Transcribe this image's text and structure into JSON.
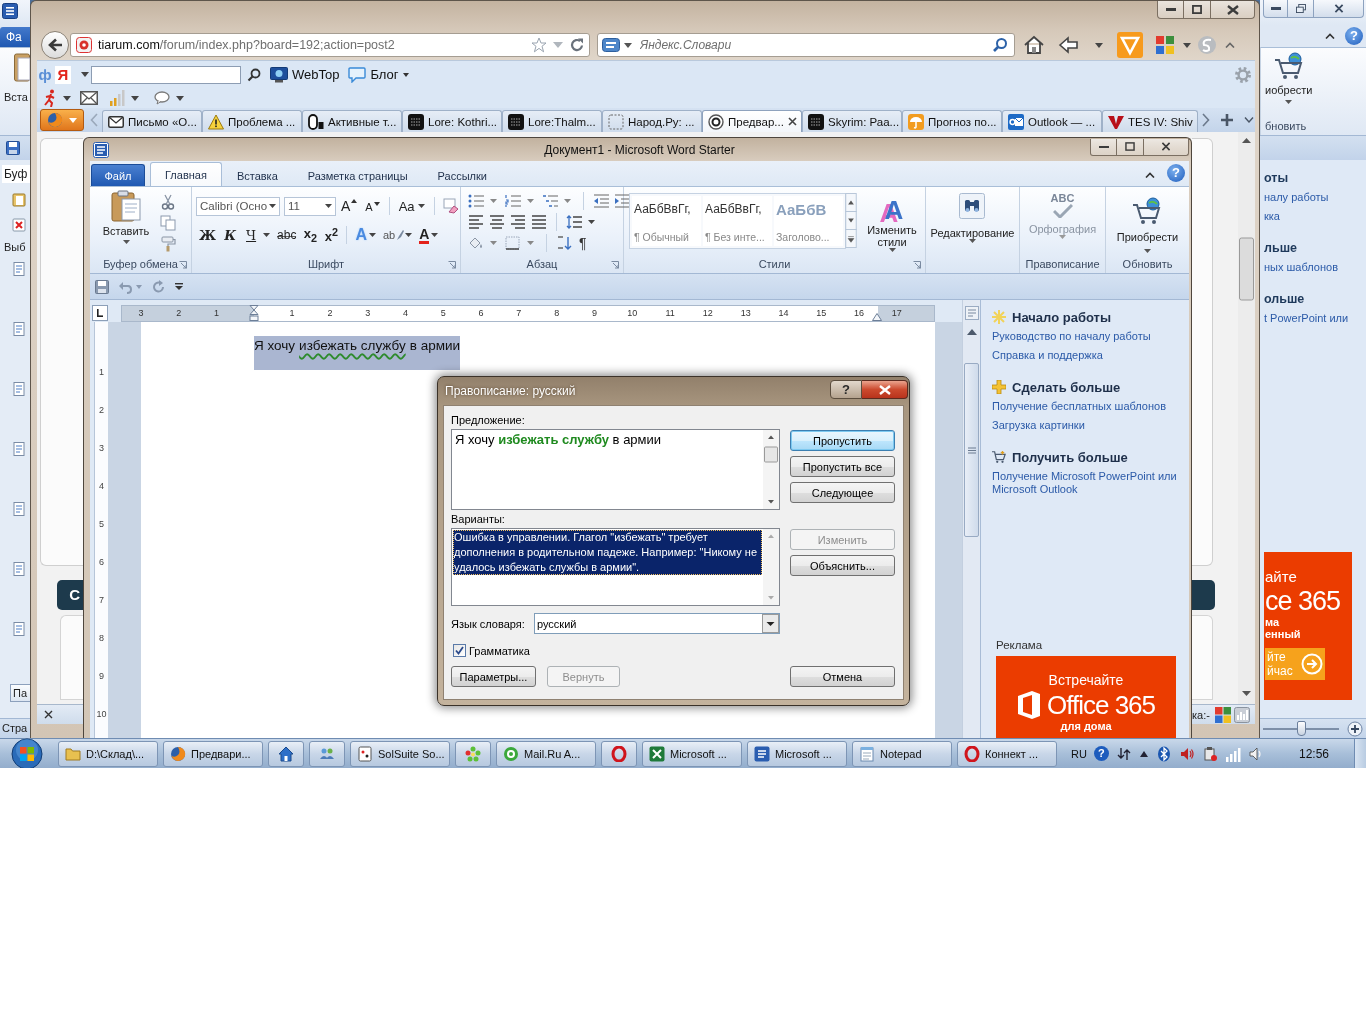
{
  "background_window": {
    "left": {
      "file_tab": "Фа",
      "paste_label": "Вста",
      "pane_title": "Буф",
      "pane_label": "Выб",
      "pane_button": "Па",
      "status": "Стра"
    },
    "right": {
      "help": "?",
      "buy_label": "иобрести",
      "group_label": "бновить",
      "pane": [
        {
          "kind": "heading",
          "text": "оты"
        },
        {
          "kind": "link",
          "text": "налу работы"
        },
        {
          "kind": "link",
          "text": "кка"
        },
        {
          "kind": "heading",
          "text": "льше"
        },
        {
          "kind": "link",
          "text": "ных шаблонов"
        },
        {
          "kind": "heading",
          "text": "ольше"
        },
        {
          "kind": "link",
          "text": "t PowerPoint или"
        }
      ],
      "ad_title": "айте",
      "ad_product": "ce 365",
      "ad_small_lines": [
        "ма",
        "енный"
      ],
      "ad_button_lines": [
        "йте",
        "йчас"
      ],
      "zoom_slider": {
        "level": 0.5
      }
    }
  },
  "browser": {
    "address": {
      "host": "tiarum.com",
      "path": "/forum/index.php?board=192;action=post2"
    },
    "search": {
      "placeholder": "Яндекс.Словари"
    },
    "toolbar_marks": [
      {
        "text": "ф",
        "color": "#5b8fd6"
      },
      {
        "text": "Я",
        "color": "#e3241b"
      }
    ],
    "toolbar_buttons": [
      {
        "label": "WebTop",
        "kind": "monitor",
        "menu": false
      },
      {
        "label": "Блог",
        "kind": "bubble",
        "menu": true
      }
    ],
    "tabs": [
      {
        "label": "Письмо «О...",
        "kind": "envelope",
        "selected": false
      },
      {
        "label": "Проблема ...",
        "kind": "warning",
        "selected": false
      },
      {
        "label": "Активные т...",
        "kind": "capsule",
        "selected": false
      },
      {
        "label": "Lore: Kothri...",
        "kind": "dark-tile",
        "selected": false
      },
      {
        "label": "Lore:Thalm...",
        "kind": "dark-tile",
        "selected": false
      },
      {
        "label": "Народ.Ру: ...",
        "kind": "dashed",
        "selected": false
      },
      {
        "label": "Предвар...",
        "kind": "round",
        "selected": true
      },
      {
        "label": "Skyrim: Раа...",
        "kind": "dark-tile",
        "selected": false
      },
      {
        "label": "Прогноз по...",
        "kind": "umbrella",
        "selected": false
      },
      {
        "label": "Outlook — ...",
        "kind": "mail-tile",
        "selected": false
      },
      {
        "label": "TES IV: Shiv",
        "kind": "v-mark",
        "selected": false
      }
    ],
    "page_heading": "C",
    "status": "ка:-"
  },
  "word": {
    "title": "Документ1 - Microsoft Word Starter",
    "help": "?",
    "tabs": [
      {
        "label": "Файл",
        "kind": "file",
        "selected": false
      },
      {
        "label": "Главная",
        "kind": "tab",
        "selected": true
      },
      {
        "label": "Вставка",
        "kind": "tab",
        "selected": false
      },
      {
        "label": "Разметка страницы",
        "kind": "tab",
        "selected": false
      },
      {
        "label": "Рассылки",
        "kind": "tab",
        "selected": false
      }
    ],
    "clipboard": {
      "paste": "Вставить",
      "label": "Буфер обмена"
    },
    "font": {
      "name": "Calibri (Осно",
      "size": "11",
      "grow": "A",
      "shrink": "A",
      "case": "Aa",
      "formats": [
        {
          "label": "Ж",
          "kind": "bold"
        },
        {
          "label": "К",
          "kind": "italic"
        },
        {
          "label": "Ч",
          "kind": "underline"
        },
        {
          "label": "abc",
          "kind": "strike"
        },
        {
          "label": "x$_{2}$",
          "kind": "sub"
        },
        {
          "label": "x$^{2}$",
          "kind": "sup"
        }
      ],
      "effects": "A",
      "highlight": "ab",
      "color_glyph": "A",
      "label": "Шрифт"
    },
    "paragraph": {
      "pilcrow": "¶",
      "label": "Абзац"
    },
    "styles": {
      "items": [
        {
          "sample": "АаБбВвГг,",
          "name": "¶ Обычный",
          "kind": "body"
        },
        {
          "sample": "АаБбВвГг,",
          "name": "¶ Без инте...",
          "kind": "body"
        },
        {
          "sample": "АаБбВ",
          "name": "Заголово...",
          "kind": "heading"
        }
      ],
      "change_glyph": "A",
      "change_lines": [
        "Изменить",
        "стили"
      ],
      "label": "Стили"
    },
    "editing": {
      "button": "Редактирование"
    },
    "proofing": {
      "glyph": "ABC",
      "button": "Орфография",
      "disabled": true,
      "label": "Правописание"
    },
    "upgrade": {
      "button": "Приобрести",
      "label": "Обновить"
    },
    "ruler": {
      "labels": [
        "3",
        "2",
        "1",
        "1",
        "2",
        "3",
        "4",
        "5",
        "6",
        "7",
        "8",
        "9",
        "10",
        "11",
        "12",
        "13",
        "14",
        "15",
        "16",
        "17"
      ],
      "vertical_labels": [
        "1",
        "2",
        "3",
        "4",
        "5",
        "6",
        "7",
        "8",
        "9",
        "10"
      ]
    },
    "document": {
      "selected": true,
      "segments": [
        {
          "text": "Я хочу",
          "flagged": false
        },
        {
          "text": "избежать службу",
          "flagged": true
        },
        {
          "text": "в армии",
          "flagged": false
        }
      ]
    },
    "task_pane": {
      "sections": [
        {
          "kind": "start",
          "heading": "Начало работы",
          "links": [
            "Руководство по началу работы",
            "Справка и поддержка"
          ]
        },
        {
          "kind": "more",
          "heading": "Сделать больше",
          "links": [
            "Получение бесплатных шаблонов",
            "Загрузка картинки"
          ]
        },
        {
          "kind": "get",
          "heading": "Получить больше",
          "links": [
            "Получение Microsoft PowerPoint или Microsoft Outlook"
          ]
        }
      ],
      "ad_label": "Реклама",
      "ad": {
        "title": "Встречайте",
        "product": "Office 365",
        "subtitle": "для дома"
      }
    }
  },
  "dialog": {
    "title": "Правописание: русский",
    "help": "?",
    "sentence_label": "Предложение:",
    "sentence": "Я хочу **избежать службу** в армии",
    "side_buttons": [
      {
        "label": "Пропустить",
        "default": true,
        "disabled": false
      },
      {
        "label": "Пропустить все",
        "default": false,
        "disabled": false
      },
      {
        "label": "Следующее",
        "default": false,
        "disabled": false
      }
    ],
    "suggestions_label": "Варианты:",
    "suggestions": [
      {
        "text": "Ошибка в управлении. Глагол \"избежать\" требует дополнения в родительном падеже. Например: \"Никому не удалось избежать службы в армии\".",
        "selected": true
      }
    ],
    "suggestion_buttons": [
      {
        "label": "Изменить",
        "disabled": true
      },
      {
        "label": "Объяснить...",
        "disabled": false
      }
    ],
    "language_label": "Язык словаря:",
    "language": "русский",
    "grammar": {
      "label": "Грамматика",
      "checked": true
    },
    "footer_buttons": [
      {
        "label": "Параметры...",
        "disabled": false
      },
      {
        "label": "Вернуть",
        "disabled": true
      },
      {
        "label": "Отмена",
        "disabled": false
      }
    ]
  },
  "taskbar": {
    "items": [
      {
        "label": "D:\\Склад\\...",
        "kind": "folder"
      },
      {
        "label": "Предвари...",
        "kind": "browser"
      },
      {
        "kind": "house"
      },
      {
        "kind": "people"
      },
      {
        "label": "SolSuite So...",
        "kind": "cards"
      },
      {
        "kind": "flower"
      },
      {
        "label": "Mail.Ru A...",
        "kind": "at"
      },
      {
        "kind": "ring"
      },
      {
        "label": "Microsoft ...",
        "kind": "sheet"
      },
      {
        "label": "Microsoft ...",
        "kind": "doc"
      },
      {
        "label": "Notepad",
        "kind": "notepad"
      },
      {
        "label": "Коннект ...",
        "kind": "ring"
      }
    ],
    "language": "RU",
    "help": "?",
    "clock": "12:56"
  }
}
